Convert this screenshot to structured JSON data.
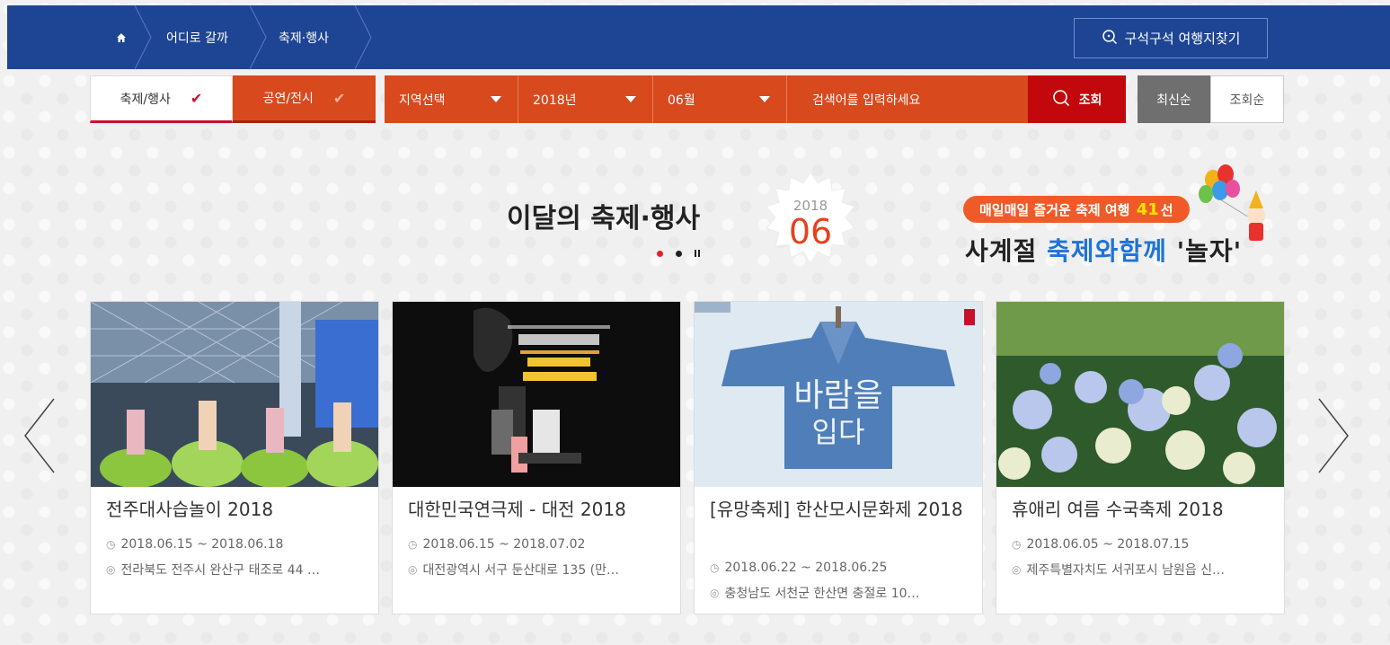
{
  "breadcrumb": {
    "home_icon": "home-icon",
    "items": [
      "어디로 갈까",
      "축제·행사"
    ]
  },
  "find_button": {
    "label": "구석구석 여행지찾기",
    "icon": "search-icon"
  },
  "filters": {
    "tab_festival": "축제/행사",
    "tab_show": "공연/전시",
    "region": "지역선택",
    "year": "2018년",
    "month": "06월",
    "search_placeholder": "검색어를 입력하세요",
    "search_button": "조회",
    "sort_latest": "최신순",
    "sort_views": "조회순"
  },
  "headline": {
    "title": "이달의 축제·행사",
    "year": "2018",
    "month": "06"
  },
  "promo": {
    "pill_prefix": "매일매일 즐거운 축제 여행",
    "pill_number": "41",
    "pill_suffix": "선",
    "main_left": "사계절",
    "main_blue": "축제와함께",
    "main_right": "'놀자'"
  },
  "cards": [
    {
      "title": "전주대사습놀이 2018",
      "date": "2018.06.15 ~ 2018.06.18",
      "location": "전라북도 전주시 완산구 태조로 44 …"
    },
    {
      "title": "대한민국연극제 - 대전 2018",
      "date": "2018.06.15 ~ 2018.07.02",
      "location": "대전광역시 서구 둔산대로 135 (만…"
    },
    {
      "title": "[유망축제] 한산모시문화제 2018",
      "date": "2018.06.22 ~ 2018.06.25",
      "location": "충청남도 서천군 한산면 충절로 10…"
    },
    {
      "title": "휴애리 여름 수국축제 2018",
      "date": "2018.06.05 ~ 2018.07.15",
      "location": "제주특별자치도 서귀포시 남원읍 신…"
    }
  ],
  "colors": {
    "nav_blue": "#1e4594",
    "filter_orange": "#d8491e",
    "search_red": "#c2070d",
    "accent_orange": "#e4431e"
  }
}
